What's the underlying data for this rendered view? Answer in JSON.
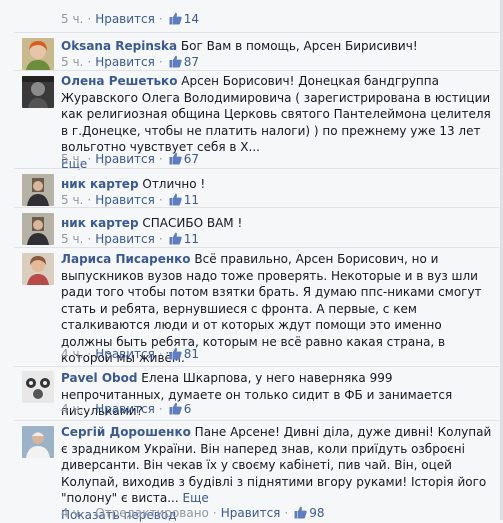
{
  "top_meta": {
    "time": "5 ч.",
    "like_label": "Нравится",
    "likes": "14"
  },
  "comments": [
    {
      "author": "Oksana Repinska",
      "text": "Бог Вам в помощь, Арсен Бирисивич!",
      "more": "",
      "time": "5 ч.",
      "like_label": "Нравится",
      "likes": "87"
    },
    {
      "author": "Олена Решетько",
      "text": "Арсен Борисович! Донецкая бандгруппа Журавского Олега Володимировича ( зарегистрирована в юстиции как религиозная община Церковь святого Пантелеймона целителя в г.Донецке, чтобы не платить налоги) ) по прежнему уже 13 лет вольготно чувствует себя в Х...",
      "more": "Еще",
      "time": "5 ч.",
      "like_label": "Нравится",
      "likes": "67"
    },
    {
      "author": "ник картер",
      "text": "Отлично !",
      "more": "",
      "time": "5 ч.",
      "like_label": "Нравится",
      "likes": "11"
    },
    {
      "author": "ник картер",
      "text": "СПАСИБО ВАМ !",
      "more": "",
      "time": "5 ч.",
      "like_label": "Нравится",
      "likes": "11"
    },
    {
      "author": "Лариса Писаренко",
      "text": "Всё правильно, Арсен Борисович, но и выпускников вузов надо тоже проверять. Некоторые и в вуз шли ради того чтобы потом взятки брать. Я думаю ппс-никами смогут стать и ребята, вернувшиеся с фронта. А первые, с кем сталкиваются люди и от которых ждут помощи это именно должны быть ребята, которым не всё равно какая страна, в которой мы живём.",
      "more": "",
      "time": "4 ч.",
      "like_label": "Нравится",
      "likes": "81"
    },
    {
      "author": "Pavel Obod",
      "text": "Елена Шкарпова, у него наверняка 999 непрочитанных, думаете он только сидит в ФБ и занимается писульками?",
      "more": "",
      "time": "4 ч.",
      "like_label": "Нравится",
      "likes": "6"
    },
    {
      "author": "Сергій Дорошенко",
      "text": "Пане Арсене! Дивні діла, дуже дивні! Колупай є зрадником України. Він наперед знав, коли приїдуть озброєні диверсанти. Він чекав їх у своєму кабінеті, пив чай. Він, оцей Колупай, виходив з будівлі з піднятими вгору руками! Історія його \"полону\" є виста...",
      "more": "Еще",
      "translate": "Показать перевод",
      "time": "4 ч.",
      "reply_label": "Отредактировано",
      "like_label": "Нравится",
      "likes": "98"
    }
  ]
}
